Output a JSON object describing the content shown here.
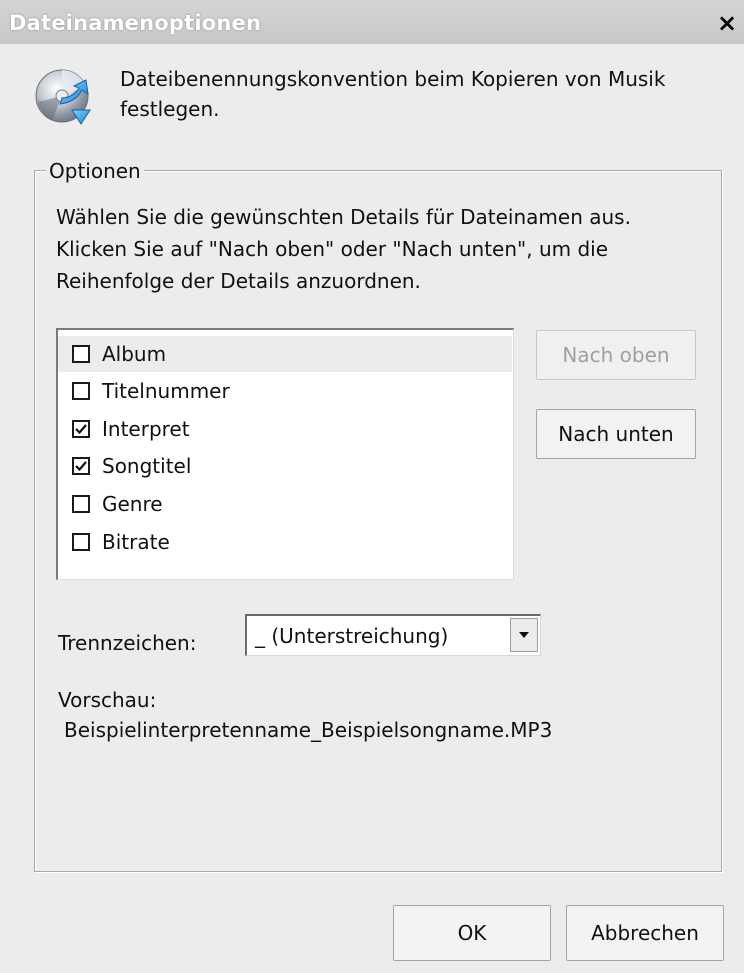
{
  "window": {
    "title": "Dateinamenoptionen",
    "close_label": "×"
  },
  "header": {
    "icon": "disc-rip-icon",
    "text": "Dateibenennungskonvention beim Kopieren von Musik festlegen."
  },
  "options": {
    "legend": "Optionen",
    "instructions": "Wählen Sie die gewünschten Details für Dateinamen aus. Klicken Sie auf \"Nach oben\" oder \"Nach unten\", um die Reihenfolge der Details anzuordnen.",
    "details": [
      {
        "label": "Album",
        "checked": false,
        "selected": true
      },
      {
        "label": "Titelnummer",
        "checked": false,
        "selected": false
      },
      {
        "label": "Interpret",
        "checked": true,
        "selected": false
      },
      {
        "label": "Songtitel",
        "checked": true,
        "selected": false
      },
      {
        "label": "Genre",
        "checked": false,
        "selected": false
      },
      {
        "label": "Bitrate",
        "checked": false,
        "selected": false
      }
    ],
    "move_up_label": "Nach oben",
    "move_down_label": "Nach unten",
    "separator_label": "Trennzeichen:",
    "separator_value": "_ (Unterstreichung)",
    "preview_label": "Vorschau:",
    "preview_value": "Beispielinterpretenname_Beispielsongname.MP3"
  },
  "buttons": {
    "ok_label": "OK",
    "cancel_label": "Abbrechen"
  }
}
